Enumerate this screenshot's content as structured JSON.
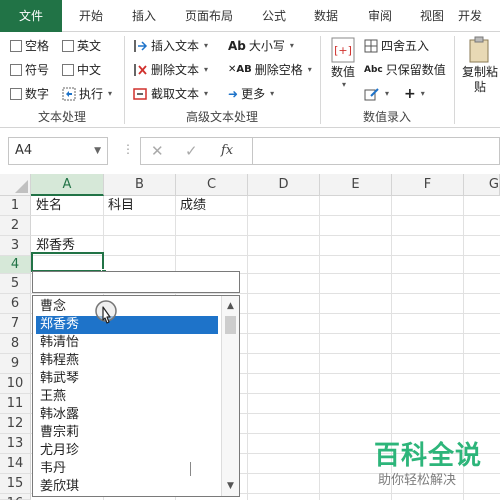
{
  "ribbon_tabs": [
    "文件",
    "开始",
    "插入",
    "页面布局",
    "公式",
    "数据",
    "审阅",
    "视图",
    "开发"
  ],
  "text_group": {
    "items": [
      "空格",
      "英文",
      "符号",
      "中文",
      "数字",
      "执行"
    ],
    "label": "文本处理"
  },
  "adv_group": {
    "items": [
      "插入文本",
      "删除文本",
      "截取文本",
      "大小写",
      "删除空格",
      "更多"
    ],
    "label": "高级文本处理"
  },
  "num_group": {
    "big_label": "数值",
    "items": [
      "四舍五入",
      "只保留数值"
    ],
    "label": "数值录入"
  },
  "copy_group": {
    "label_line1": "复制粘",
    "label_line2": "贴"
  },
  "formula_bar": {
    "name_box": "A4",
    "fx": "fx"
  },
  "grid": {
    "columns": [
      "A",
      "B",
      "C",
      "D",
      "E",
      "F",
      "G"
    ],
    "rows": [
      "1",
      "2",
      "3",
      "4",
      "5",
      "6",
      "7",
      "8",
      "9",
      "10",
      "11",
      "12",
      "13",
      "14",
      "15",
      "16"
    ],
    "cells": {
      "a1": "姓名",
      "b1": "科目",
      "c1": "成绩",
      "a3": "郑香秀"
    }
  },
  "combo": {
    "items": [
      "曹念",
      "郑香秀",
      "韩清怡",
      "韩程燕",
      "韩武琴",
      "王燕",
      "韩冰露",
      "曹宗莉",
      "尤月珍",
      "韦丹",
      "姜欣琪"
    ],
    "highlighted_index": 1
  },
  "watermark": {
    "title": "百科全说",
    "subtitle": "助你轻松解决"
  },
  "colors": {
    "accent": "#217346",
    "highlight": "#1e73c9",
    "watermark": "#2db57a"
  }
}
